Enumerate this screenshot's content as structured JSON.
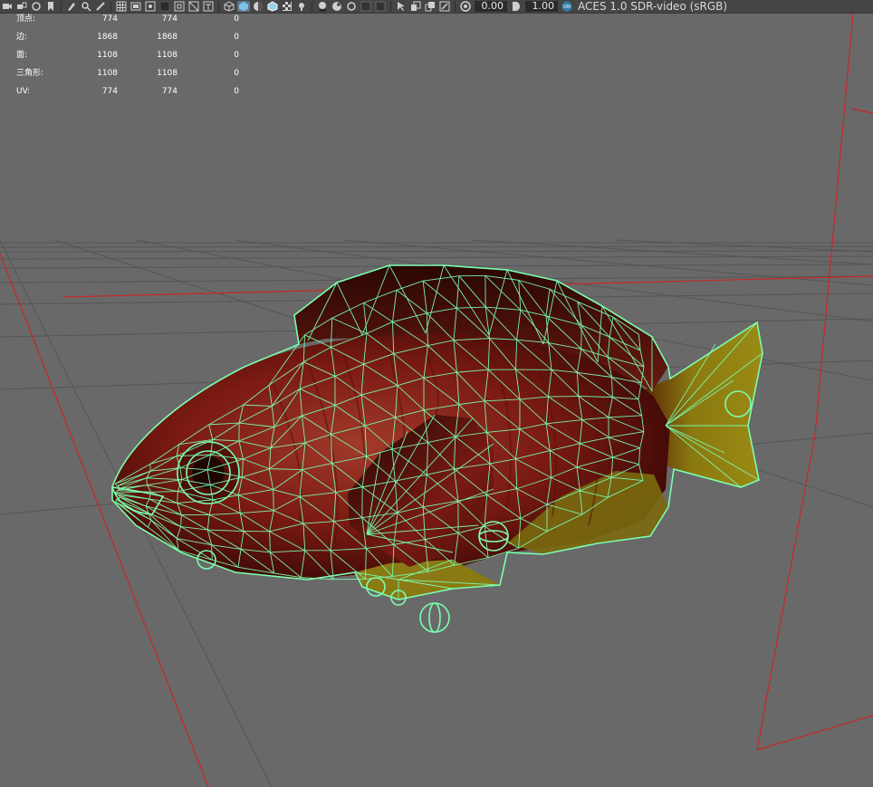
{
  "toolbar": {
    "icons": [
      "camera-icon",
      "camera-lock-icon",
      "camera-attributes-icon",
      "bookmark-icon",
      "image-plane-icon",
      "pan-zoom-icon",
      "grease-pencil-icon",
      "grid-icon",
      "film-gate-icon",
      "resolution-gate-icon",
      "gate-mask-icon",
      "field-chart-icon",
      "safe-action-icon",
      "safe-title-icon",
      "wireframe-icon",
      "smooth-shade-icon",
      "default-material-icon",
      "shaded-wireframe-icon",
      "textured-icon",
      "use-all-lights-icon",
      "shadows-icon",
      "screen-space-ao-icon",
      "motion-blur-icon",
      "anti-aliasing-icon",
      "depth-of-field-icon",
      "isolate-select-icon",
      "xray-icon",
      "xray-active-components-icon",
      "xray-joints-icon",
      "exposure-icon",
      "gamma-icon",
      "color-management-icon"
    ],
    "exposure_value": "0.00",
    "gamma_value": "1.00",
    "color_management_badge": "ON",
    "color_space": "ACES 1.0 SDR-video (sRGB)"
  },
  "hud": {
    "rows": [
      {
        "label": "顶点:",
        "c1": "774",
        "c2": "774",
        "c3": "0"
      },
      {
        "label": "边:",
        "c1": "1868",
        "c2": "1868",
        "c3": "0"
      },
      {
        "label": "面:",
        "c1": "1108",
        "c2": "1108",
        "c3": "0"
      },
      {
        "label": "三角形:",
        "c1": "1108",
        "c2": "1108",
        "c3": "0"
      },
      {
        "label": "UV:",
        "c1": "774",
        "c2": "774",
        "c3": "0"
      }
    ]
  },
  "colors": {
    "viewport_bg": "#696969",
    "toolbar_bg": "#454545",
    "grid_line": "#555555",
    "axis_red": "#c82828",
    "wireframe": "#7affb0",
    "body_red": "#7a1a12",
    "tail_yellow": "#8a8a10"
  }
}
